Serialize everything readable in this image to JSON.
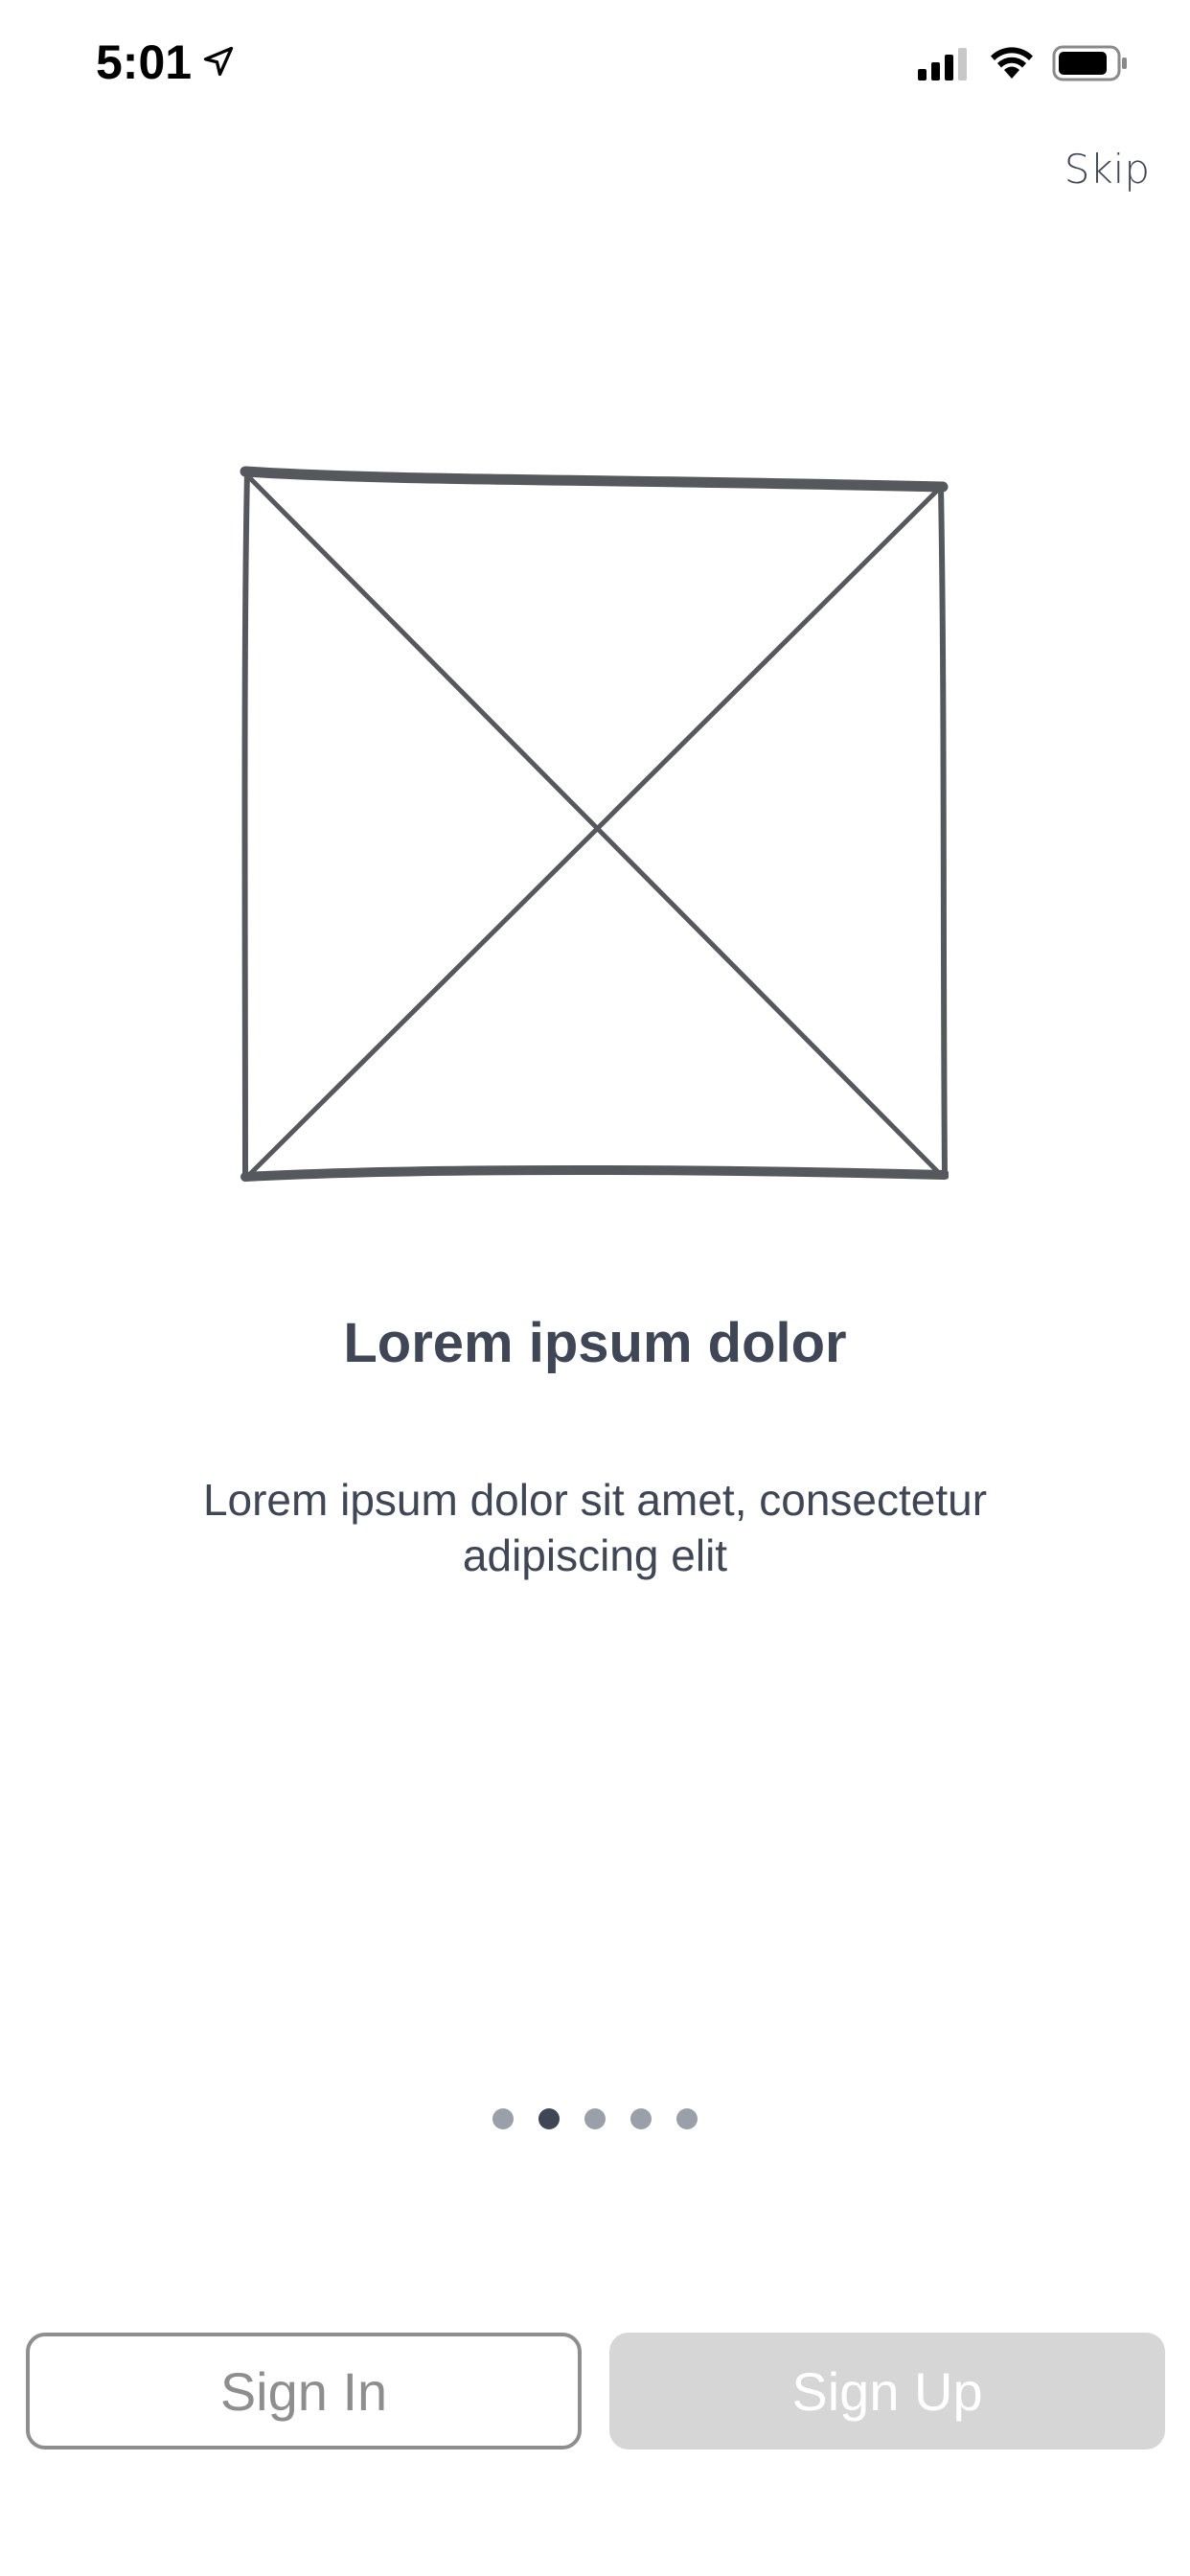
{
  "status_bar": {
    "time": "5:01",
    "icons": [
      "location-arrow-icon",
      "cellular-signal-icon",
      "wifi-icon",
      "battery-icon"
    ]
  },
  "header": {
    "skip_label": "Skip"
  },
  "onboarding": {
    "image_placeholder": "image-placeholder-icon",
    "title": "Lorem ipsum dolor",
    "body": "Lorem ipsum dolor sit amet, consectetur adipiscing elit",
    "pager": {
      "total_pages": 5,
      "active_page": 2
    }
  },
  "actions": {
    "sign_in_label": "Sign In",
    "sign_up_label": "Sign Up"
  },
  "colors": {
    "text": "#3f4656",
    "dot_inactive": "#9aa0a9",
    "dot_active": "#3f4656",
    "sign_in_border": "#8e8e8e",
    "sign_up_bg": "#d6d6d6"
  }
}
